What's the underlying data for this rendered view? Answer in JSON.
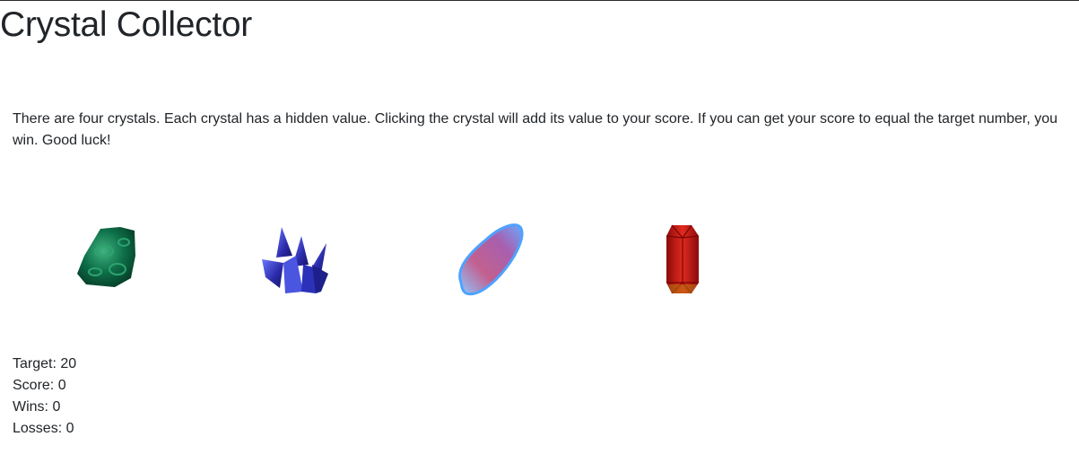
{
  "header": {
    "title": "Crystal Collector"
  },
  "instructions": "There are four crystals. Each crystal has a hidden value. Clicking the crystal will add its value to your score. If you can get your score to equal the target number, you win. Good luck!",
  "crystals": [
    {
      "name": "green-crystal",
      "color": "#0f7a4f"
    },
    {
      "name": "blue-crystal",
      "color": "#2f2fb3"
    },
    {
      "name": "pink-crystal",
      "color": "#b85a8c"
    },
    {
      "name": "red-crystal",
      "color": "#c41212"
    }
  ],
  "stats": {
    "target_label": "Target: ",
    "target": "20",
    "score_label": "Score: ",
    "score": "0",
    "wins_label": "Wins: ",
    "wins": "0",
    "losses_label": "Losses: ",
    "losses": "0"
  }
}
